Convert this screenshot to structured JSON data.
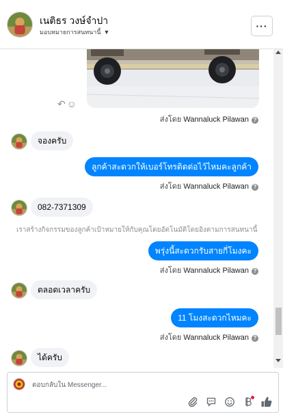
{
  "header": {
    "contact_name": "เนติธร วงษ์จำปา",
    "assign_label": "มอบหมายการสนทนานี้",
    "menu_glyph": "···"
  },
  "messages": {
    "photo_alt": "Truck photo",
    "reply_icon": "reply-icon",
    "emoji_icon": "smiley-icon",
    "sent_by_1": {
      "prefix": "ส่งโดย",
      "name": "Wannaluck Pilawan"
    },
    "in_1": "จองครับ",
    "out_1": "ลูกค้าสะดวกให้เบอร์โทรติดต่อไว้ไหมคะลูกค้า",
    "sent_by_2": {
      "prefix": "ส่งโดย",
      "name": "Wannaluck Pilawan"
    },
    "in_2": "082-7371309",
    "system_note": "เราสร้างกิจกรรมของลูกค้าเป้าหมายให้กับคุณโดยอัตโนมัติโดยอิงตามการสนทนานี้",
    "out_2": "พรุ่งนี้สะดวกรับสายกี่โมงคะ",
    "sent_by_3": {
      "prefix": "ส่งโดย",
      "name": "Wannaluck Pilawan"
    },
    "in_3": "ตลอดเวลาครับ",
    "out_3": "11 โมงสะดวกไหมคะ",
    "sent_by_4": {
      "prefix": "ส่งโดย",
      "name": "Wannaluck Pilawan"
    },
    "in_4": "ได้ครับ"
  },
  "composer": {
    "placeholder": "ตอบกลับใน Messenger...",
    "tools": [
      "paperclip-icon",
      "chat-bubble-icon",
      "emoji-icon",
      "bot-icon",
      "thumbs-up-icon"
    ]
  },
  "colors": {
    "accent": "#0084ff",
    "incoming_bubble": "#f0f2f5",
    "notification": "#e41e3f"
  }
}
